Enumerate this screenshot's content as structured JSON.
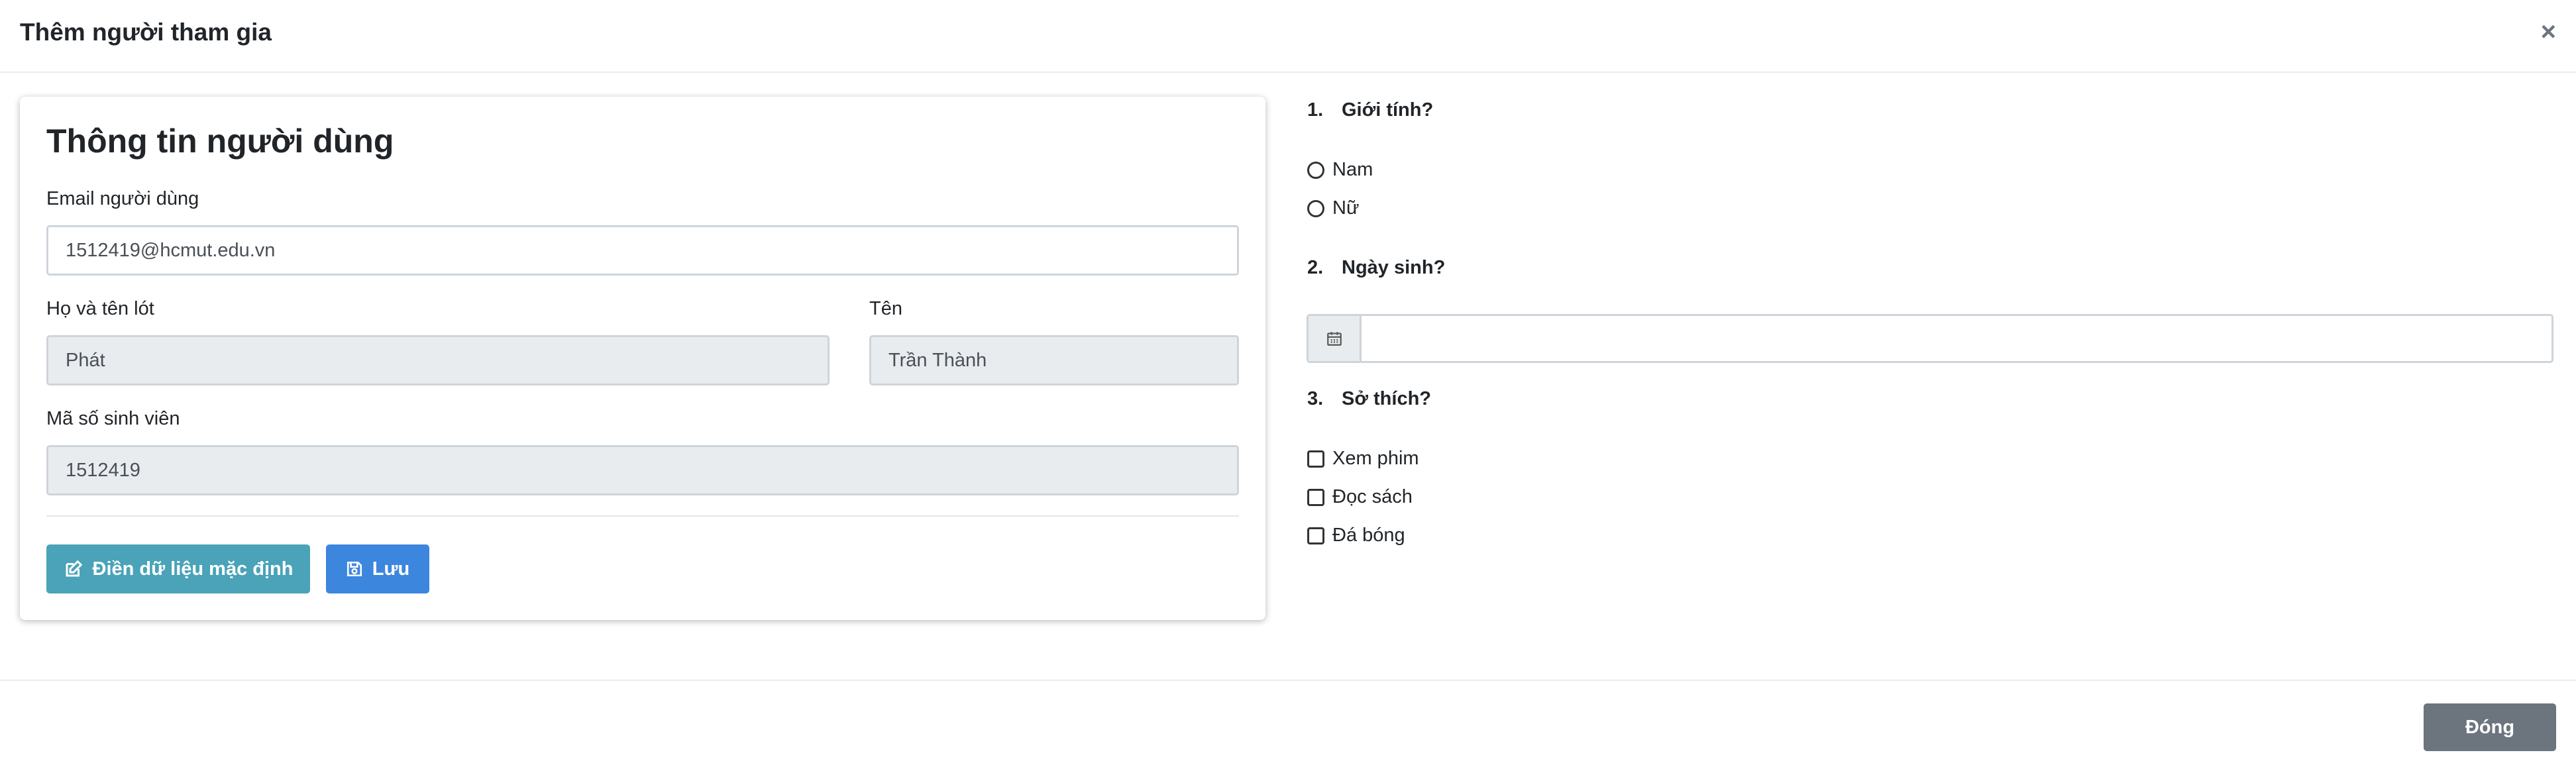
{
  "modal": {
    "title": "Thêm người tham gia",
    "close_symbol": "×",
    "close_button_label": "Đóng"
  },
  "user_form": {
    "title": "Thông tin người dùng",
    "email_label": "Email người dùng",
    "email_value": "1512419@hcmut.edu.vn",
    "lastname_label": "Họ và tên lót",
    "lastname_value": "Phát",
    "firstname_label": "Tên",
    "firstname_value": "Trần Thành",
    "student_id_label": "Mã số sinh viên",
    "student_id_value": "1512419",
    "fill_default_label": "Điền dữ liệu mặc định",
    "save_label": "Lưu",
    "fill_default_icon": "edit-icon",
    "save_icon": "save-icon"
  },
  "questions": [
    {
      "number": "1.",
      "title": "Giới tính?",
      "type": "radio",
      "options": [
        "Nam",
        "Nữ"
      ]
    },
    {
      "number": "2.",
      "title": "Ngày sinh?",
      "type": "date",
      "value": "",
      "icon": "calendar-icon"
    },
    {
      "number": "3.",
      "title": "Sở thích?",
      "type": "checkbox",
      "options": [
        "Xem phim",
        "Đọc sách",
        "Đá bóng"
      ]
    }
  ],
  "colors": {
    "info": "#4aa3b8",
    "primary": "#3d86de",
    "secondary": "#6c757d",
    "readonly_bg": "#e9ecef"
  }
}
